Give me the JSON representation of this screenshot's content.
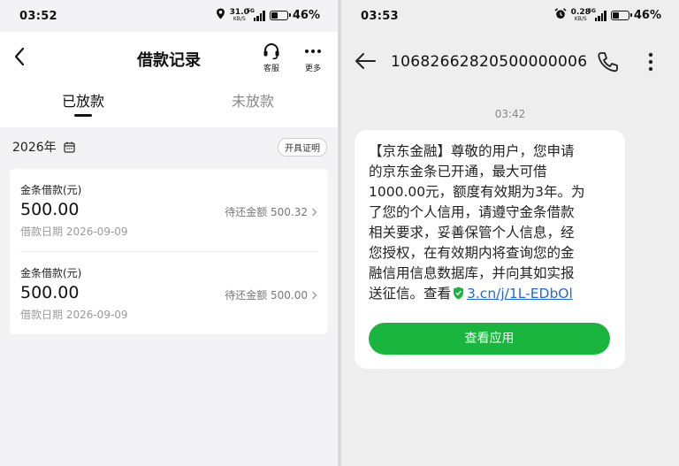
{
  "left": {
    "status": {
      "time": "03:52",
      "net_speed": "31.0",
      "net_unit": "KB/S",
      "network": "5G",
      "battery": "46%",
      "battery_level": 0.46
    },
    "header": {
      "title": "借款记录",
      "service_label": "客服",
      "more_label": "更多"
    },
    "tabs": [
      {
        "label": "已放款",
        "active": true
      },
      {
        "label": "未放款",
        "active": false
      }
    ],
    "year": "2026年",
    "certificate_button": "开具证明",
    "loans": [
      {
        "name": "金条借款(元)",
        "amount": "500.00",
        "due": "待还金额 500.32",
        "date": "借款日期 2026-09-09"
      },
      {
        "name": "金条借款(元)",
        "amount": "500.00",
        "due": "待还金额 500.00",
        "date": "借款日期 2026-09-09"
      }
    ]
  },
  "right": {
    "status": {
      "time": "03:53",
      "net_speed": "0.28",
      "net_unit": "KB/S",
      "network": "5G",
      "battery": "46%",
      "battery_level": 0.46
    },
    "sender": "10682662820500000006",
    "timestamp": "03:42",
    "message": {
      "line1": "【京东金融】尊敬的用户，您申请",
      "line2": "的京东金条已开通，最大可借",
      "line3": "1000.00元，额度有效期为3年。为",
      "line4": "了您的个人信用，请遵守金条借款",
      "line5": "相关要求，妥善保管个人信息，经",
      "line6": "您授权，在有效期内将查询您的金",
      "line7": "融信用信息数据库，并向其如实报",
      "line8_prefix": "送征信。查看",
      "link": "3.cn/j/1L-EDbOl"
    },
    "action_button": "查看应用"
  },
  "colors": {
    "accent_green": "#1ab53e",
    "link_blue": "#1f6ad8"
  },
  "icons": [
    "back-arrow-icon",
    "headset-icon",
    "more-dots-icon",
    "calendar-icon",
    "chevron-right-icon",
    "phone-icon",
    "more-vertical-icon",
    "shield-check-icon",
    "location-icon",
    "alarm-icon",
    "signal-icon",
    "battery-icon"
  ]
}
